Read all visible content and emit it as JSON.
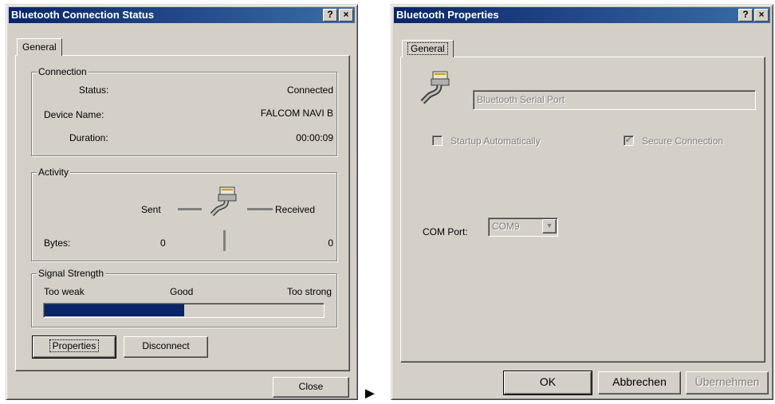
{
  "left_window": {
    "title": "Bluetooth Connection Status",
    "help_glyph": "?",
    "close_glyph": "×",
    "tab": "General",
    "connection": {
      "group_title": "Connection",
      "status_label": "Status:",
      "status_value": "Connected",
      "device_label": "Device Name:",
      "device_value": "FALCOM NAVI B",
      "duration_label": "Duration:",
      "duration_value": "00:00:09"
    },
    "activity": {
      "group_title": "Activity",
      "sent_label": "Sent",
      "received_label": "Received",
      "bytes_label": "Bytes:",
      "bytes_sent": "0",
      "bytes_received": "0"
    },
    "signal": {
      "group_title": "Signal Strength",
      "too_weak": "Too weak",
      "good": "Good",
      "too_strong": "Too strong",
      "level_fraction": 0.5,
      "bar_color": "#0a246a"
    },
    "buttons": {
      "properties": "Properties",
      "disconnect": "Disconnect",
      "close": "Close"
    }
  },
  "arrow_glyph": "►",
  "right_window": {
    "title": "Bluetooth Properties",
    "help_glyph": "?",
    "close_glyph": "×",
    "tab": "General",
    "service_name": "Bluetooth Serial Port",
    "startup_label": "Startup Automatically",
    "startup_checked": false,
    "secure_label": "Secure Connection",
    "secure_checked": true,
    "com_port_label": "COM Port:",
    "com_port_value": "COM9",
    "buttons": {
      "ok": "OK",
      "cancel": "Abbrechen",
      "apply": "Übernehmen"
    }
  },
  "icons": {
    "port": "serial-port-icon",
    "dropdown": "chevron-down-icon"
  }
}
